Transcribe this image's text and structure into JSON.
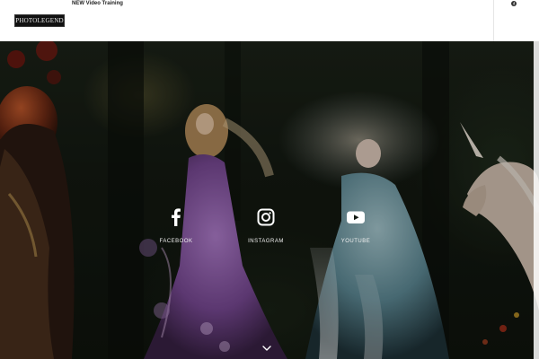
{
  "header": {
    "logo_text": "PHOTOLEGEND",
    "nav_link": "NEW Video Training",
    "rail_icon": "facebook-icon"
  },
  "social": [
    {
      "label": "FACEBOOK",
      "icon": "facebook-icon"
    },
    {
      "label": "INSTAGRAM",
      "icon": "instagram-icon"
    },
    {
      "label": "YOUTUBE",
      "icon": "youtube-icon"
    }
  ],
  "scroll_icon": "chevron-down-icon",
  "colors": {
    "header_bg": "#ffffff",
    "hero_dark": "#141a12",
    "social_white": "#ffffff",
    "dress_purple": "#8e5aa8",
    "dress_teal": "#6f9aa6",
    "hair_red": "#a0421e"
  }
}
